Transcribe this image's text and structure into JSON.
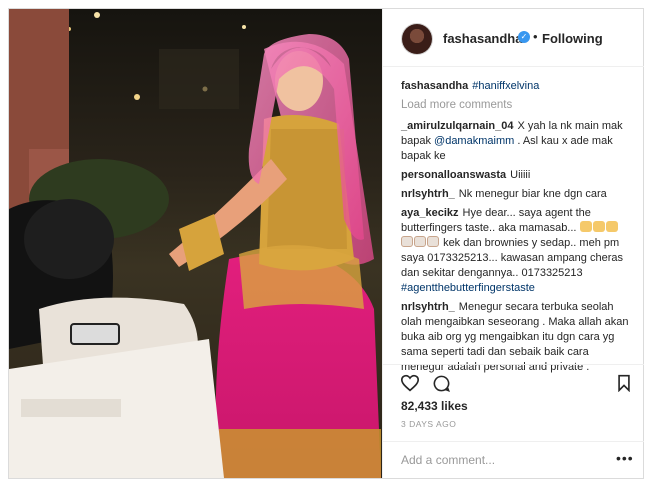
{
  "header": {
    "username": "fashasandha",
    "separator": "•",
    "follow_label": "Following"
  },
  "caption": {
    "username": "fashasandha",
    "hashtag": "#haniffxelvina"
  },
  "load_more_label": "Load more comments",
  "comments": [
    {
      "username": "_amirulzulqarnain_04",
      "parts": [
        "X yah la nk main mak bapak ",
        "@damakmaimm",
        " . Asl kau x ade mak bapak ke"
      ]
    },
    {
      "username": "personalloanswasta",
      "parts": [
        "Uiiiii"
      ]
    },
    {
      "username": "nrlsyhtrh_",
      "parts": [
        "Nk menegur biar kne dgn cara"
      ]
    },
    {
      "username": "aya_kecikz",
      "parts": [
        "Hye dear... saya agent the butterfingers taste.. aka mamasab...",
        "kek dan brownies y sedap.. meh pm saya 0173325213... kawasan ampang cheras dan sekitar dengannya.. 0173325213 ",
        "#agentthebutterfingerstaste"
      ]
    },
    {
      "username": "nrlsyhtrh_",
      "parts": [
        "Menegur secara terbuka seolah olah mengaibkan seseorang . Maka allah akan buka aib org yg mengaibkan itu dgn cara yg sama seperti tadi dan sebaik baik cara menegur adalah personal and private ."
      ]
    }
  ],
  "actions": {
    "likes": "82,433 likes",
    "date": "3 DAYS AGO"
  },
  "add_comment": {
    "placeholder": "Add a comment...",
    "more": "•••"
  },
  "colors": {
    "accent_blue": "#3897f0",
    "link": "#003569",
    "muted": "#999999"
  },
  "icons": [
    "verified-icon",
    "heart-icon",
    "comment-icon",
    "bookmark-icon",
    "more-options-icon"
  ]
}
